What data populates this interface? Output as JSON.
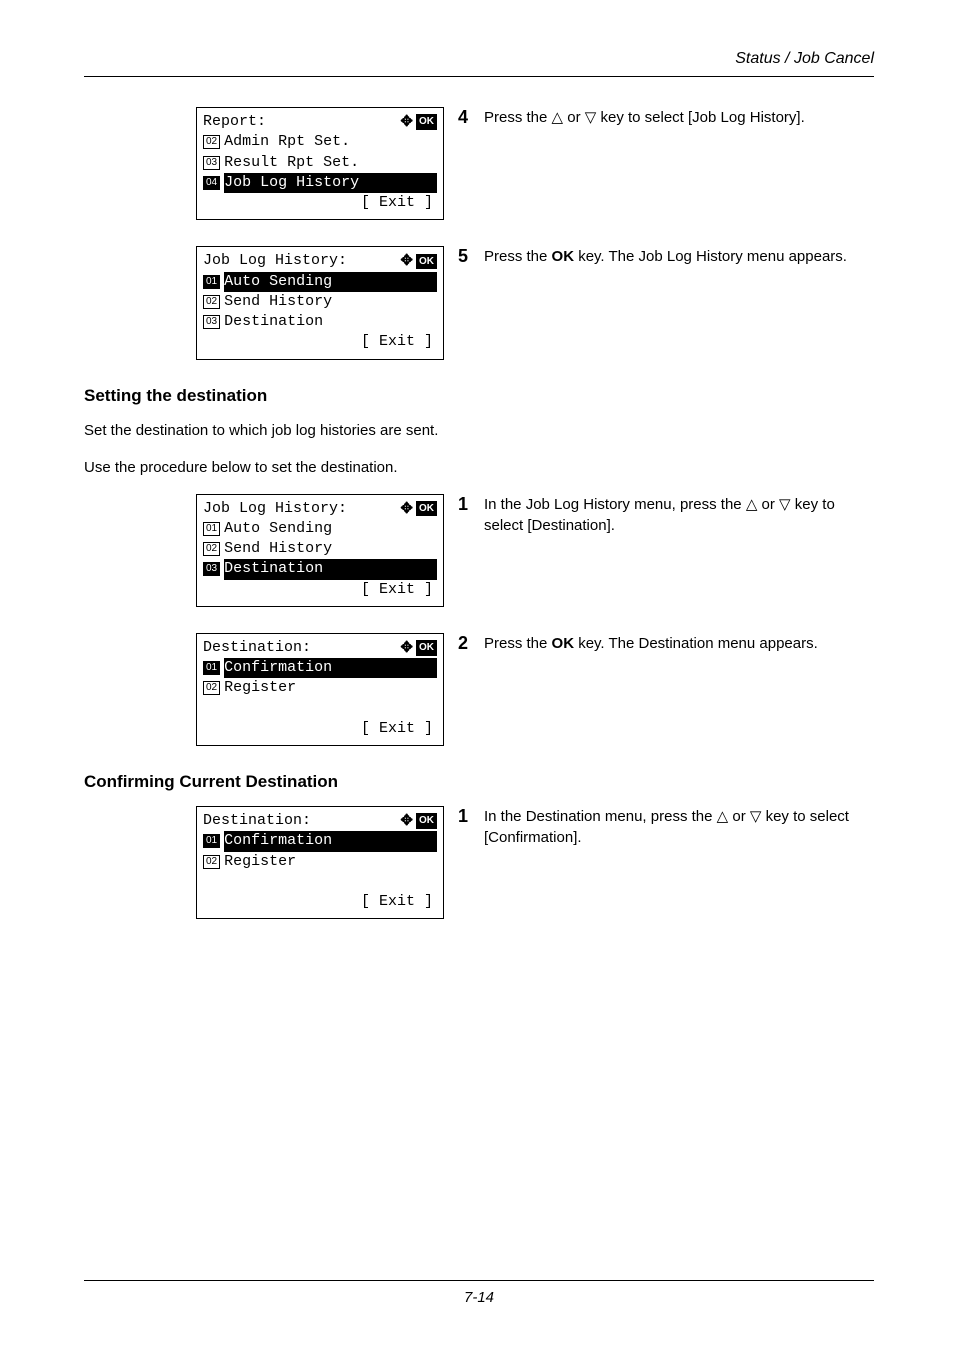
{
  "header": {
    "section": "Status / Job Cancel"
  },
  "lcd1": {
    "title": "Report:",
    "items": [
      {
        "num": "02",
        "label": "Admin Rpt Set."
      },
      {
        "num": "03",
        "label": "Result Rpt Set."
      },
      {
        "num": "04",
        "label": "Job Log History",
        "selected": true
      }
    ],
    "footer": "[  Exit   ]"
  },
  "lcd2": {
    "title": "Job Log History:",
    "items": [
      {
        "num": "01",
        "label": "Auto Sending",
        "selected": true
      },
      {
        "num": "02",
        "label": "Send History"
      },
      {
        "num": "03",
        "label": "Destination"
      }
    ],
    "footer": "[  Exit   ]"
  },
  "lcd3": {
    "title": "Job Log History:",
    "items": [
      {
        "num": "01",
        "label": "Auto Sending"
      },
      {
        "num": "02",
        "label": "Send History"
      },
      {
        "num": "03",
        "label": "Destination",
        "selected": true
      }
    ],
    "footer": "[  Exit   ]"
  },
  "lcd4": {
    "title": "Destination:",
    "items": [
      {
        "num": "01",
        "label": "Confirmation",
        "selected": true
      },
      {
        "num": "02",
        "label": "Register"
      }
    ],
    "footer": "[  Exit   ]"
  },
  "lcd5": {
    "title": "Destination:",
    "items": [
      {
        "num": "01",
        "label": "Confirmation",
        "selected": true
      },
      {
        "num": "02",
        "label": "Register"
      }
    ],
    "footer": "[  Exit   ]"
  },
  "steps": {
    "s4": {
      "num": "4",
      "pre": "Press the ",
      "post": " key to select [Job Log History]."
    },
    "s5": {
      "num": "5",
      "pre": "Press the ",
      "bold": "OK",
      "post": " key. The Job Log History menu appears."
    },
    "s3_1": {
      "num": "1",
      "pre": "In the Job Log History menu, press the ",
      "post": " key to select [Destination]."
    },
    "s3_2": {
      "num": "2",
      "pre": "Press the ",
      "bold": "OK",
      "post": " key. The Destination menu appears."
    },
    "s4_1": {
      "num": "1",
      "pre": "In the Destination menu, press the ",
      "post": " key to select [Confirmation]."
    }
  },
  "headings": {
    "h1": "Setting the destination",
    "p1": "Set the destination to which job log histories are sent.",
    "p2": "Use the procedure below to set the destination.",
    "h2": "Confirming Current Destination"
  },
  "symbols": {
    "up": "△",
    "down": "▽",
    "or": " or ",
    "okLabel": "OK"
  },
  "footer": {
    "page": "7-14"
  }
}
